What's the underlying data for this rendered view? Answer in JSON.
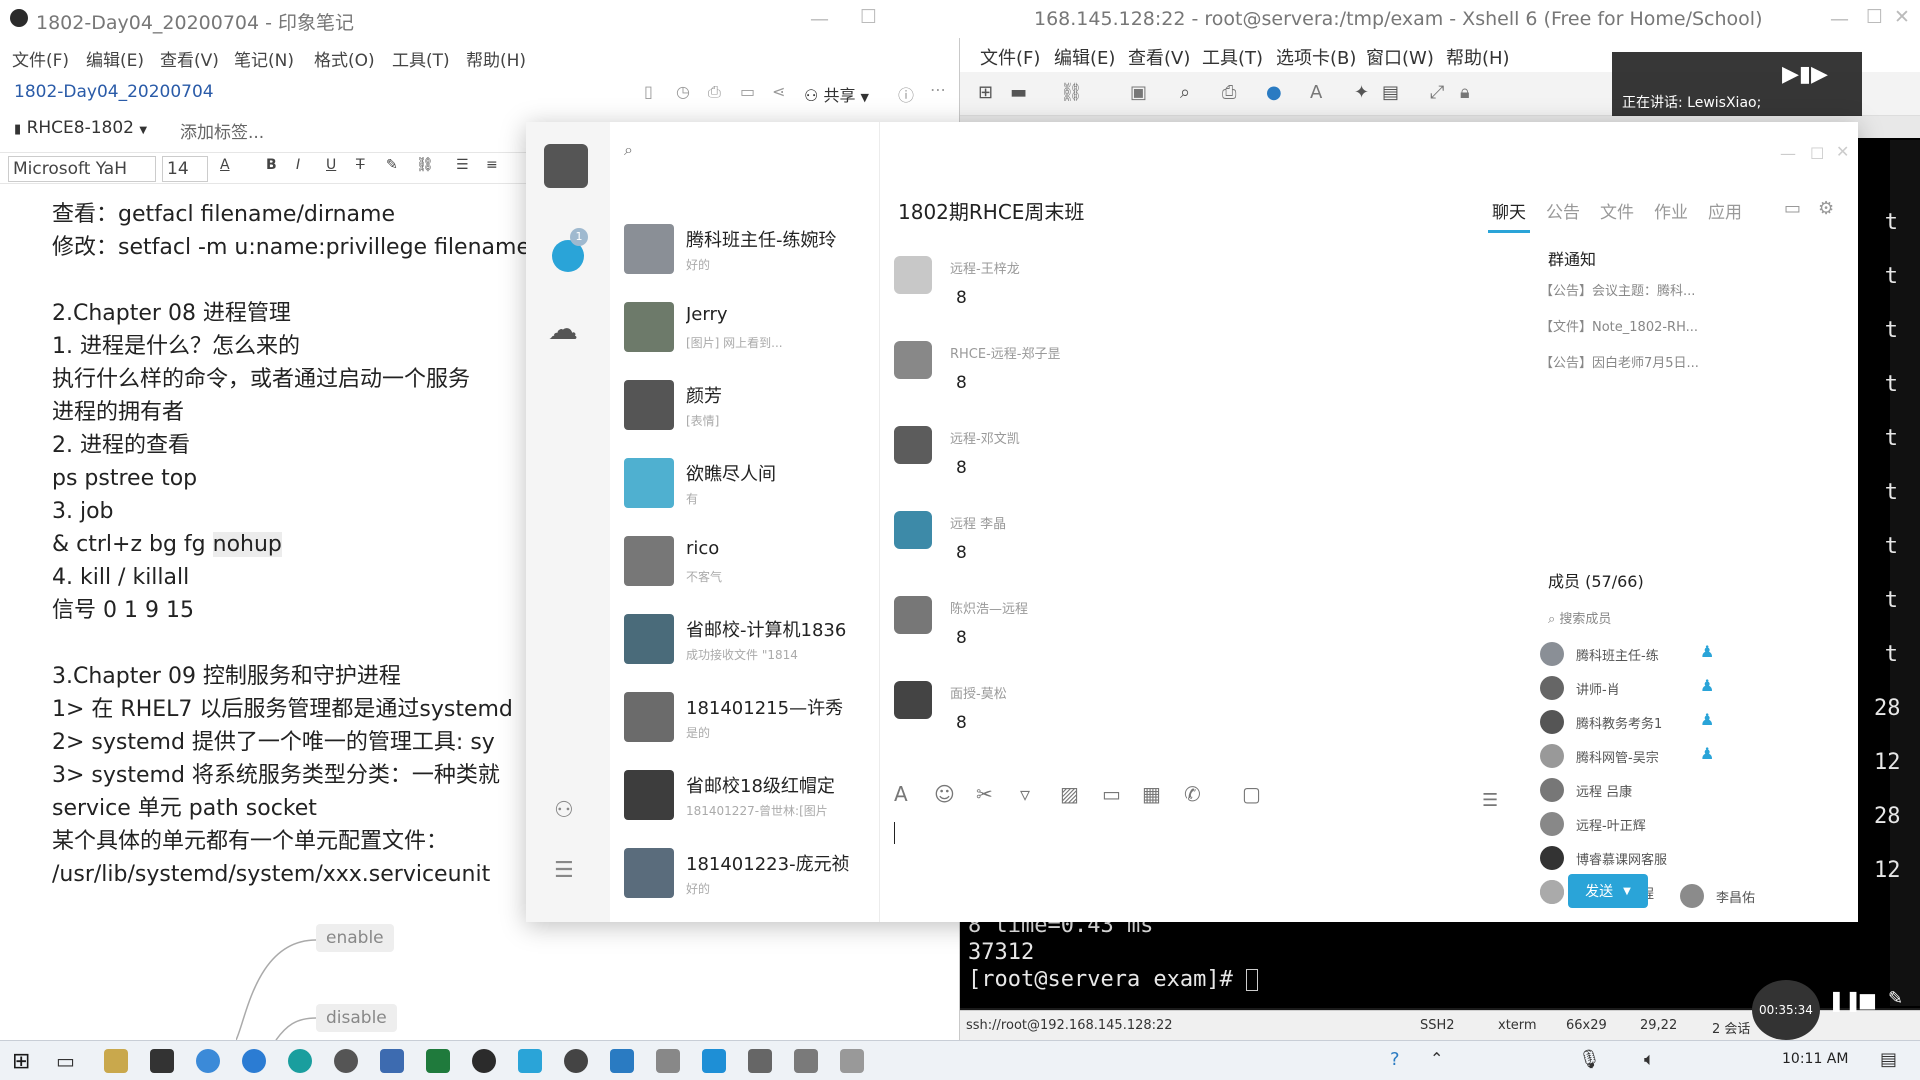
{
  "evernote": {
    "title": "1802-Day04_20200704 - 印象笔记",
    "menu": [
      "文件(F)",
      "编辑(E)",
      "查看(V)",
      "笔记(N)",
      "格式(O)",
      "工具(T)",
      "帮助(H)"
    ],
    "note_title": "1802-Day04_20200704",
    "share_label": "共享",
    "notebook": "RHCE8-1802",
    "add_tag": "添加标签...",
    "font_family": "Microsoft YaH",
    "font_size": "14",
    "content_lines": [
      "查看：getfacl filename/dirname",
      "修改：setfacl -m u:name:privillege filename",
      "",
      "2.Chapter 08  进程管理",
      "1. 进程是什么？怎么来的",
      "执行什么样的命令，或者通过启动一个服务",
      "进程的拥有者",
      "2. 进程的查看",
      "ps pstree top",
      "3. job",
      "& ctrl+z bg fg ",
      "4. kill / killall",
      "信号 0 1 9 15",
      "",
      "3.Chapter 09 控制服务和守护进程",
      "1> 在 RHEL7 以后服务管理都是通过systemd",
      "2> systemd 提供了一个唯一的管理工具:  sy",
      "3> systemd 将系统服务类型分类：一种类就",
      "service 单元 path socket",
      "某个具体的单元都有一个单元配置文件：",
      "/usr/lib/systemd/system/xxx.serviceunit"
    ],
    "highlight_word": "nohup",
    "mindmap": [
      "enable",
      "disable"
    ]
  },
  "xshell": {
    "title": "168.145.128:22 - root@servera:/tmp/exam - Xshell 6 (Free for Home/School)",
    "menu": [
      "文件(F)",
      "编辑(E)",
      "查看(V)",
      "工具(T)",
      "选项卡(B)",
      "窗口(W)",
      "帮助(H)"
    ],
    "terminal_lines": [
      "8 time=0.43 ms",
      "37312",
      "[root@servera exam]# "
    ],
    "right_column": [
      "t",
      "t",
      "t",
      "t",
      "t",
      "t",
      "t",
      "t",
      "t",
      "28",
      "12",
      "28",
      "12"
    ],
    "presenter": "正在讲话: LewisXiao;",
    "status": {
      "conn": "ssh://root@192.168.145.128:22",
      "proto": "SSH2",
      "term": "xterm",
      "size": "66x29",
      "pos": "29,22",
      "sessions": "2 会话"
    }
  },
  "qq": {
    "group_title": "1802期RHCE周末班",
    "tabs": [
      "聊天",
      "公告",
      "文件",
      "作业",
      "应用"
    ],
    "conversations": [
      {
        "name": "腾科班主任-练婉玲",
        "preview": "好的",
        "color": "#8a8f96"
      },
      {
        "name": "Jerry",
        "preview": "[图片] 网上看到...",
        "color": "#6d7a6a"
      },
      {
        "name": "颜芳",
        "preview": "[表情]",
        "color": "#555555"
      },
      {
        "name": "欲瞧尽人间",
        "preview": "有",
        "color": "#4fb0d0"
      },
      {
        "name": "rico",
        "preview": "不客气",
        "color": "#777777"
      },
      {
        "name": "省邮校-计算机1836",
        "preview": "成功接收文件 \"1814",
        "color": "#4a6b7a"
      },
      {
        "name": "181401215—许秀",
        "preview": "是的",
        "color": "#6b6b6b"
      },
      {
        "name": "省邮校18级红帽定",
        "preview": "181401227-曾世林:[图片",
        "color": "#3d3d3d"
      },
      {
        "name": "181401223-庞元祯",
        "preview": "好的",
        "color": "#5a6c7c"
      }
    ],
    "messages": [
      {
        "name": "远程-王梓龙",
        "text": "8",
        "color": "#c8c8c8"
      },
      {
        "name": "RHCE-远程-郑子昰",
        "text": "8",
        "color": "#888888"
      },
      {
        "name": "远程-邓文凯",
        "text": "8",
        "color": "#5c5c5c"
      },
      {
        "name": "远程 李晶",
        "text": "8",
        "color": "#3d8aa8"
      },
      {
        "name": "陈炽浩—远程",
        "text": "8",
        "color": "#777777"
      },
      {
        "name": "面授-莫松",
        "text": "8",
        "color": "#444444"
      }
    ],
    "notice_title": "群通知",
    "notices": [
      "【公告】会议主题：腾科...",
      "【文件】Note_1802-RH...",
      "【公告】因白老师7月5日..."
    ],
    "members_title": "成员 (57/66)",
    "member_search": "搜索成员",
    "members": [
      {
        "name": "腾科班主任-练",
        "color": "#8a8f96"
      },
      {
        "name": "讲师-肖",
        "color": "#666666"
      },
      {
        "name": "腾科教务考务1",
        "color": "#555555"
      },
      {
        "name": "腾科网管-吴宗",
        "color": "#999999"
      },
      {
        "name": "远程 吕康",
        "color": "#777777"
      },
      {
        "name": "远程-叶正辉",
        "color": "#888888"
      },
      {
        "name": "博睿慕课网客服",
        "color": "#333333"
      },
      {
        "name": "陈炽浩—远程",
        "color": "#9a9a9a"
      },
      {
        "name": "炽",
        "color": "#aaaaaa"
      },
      {
        "name": "李昌佑",
        "color": "#8b8b8b"
      }
    ],
    "send_label": "发送",
    "unread_badge": "1"
  },
  "taskbar": {
    "clock": "10:11 AM",
    "rec_timer": "00:35:34"
  }
}
